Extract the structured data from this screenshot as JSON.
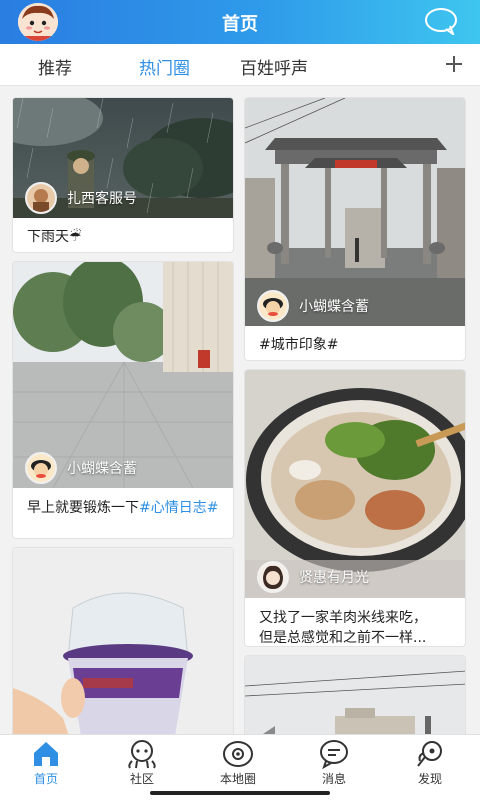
{
  "header": {
    "title": "首页"
  },
  "tabs": [
    {
      "label": "推荐"
    },
    {
      "label": "热门圈"
    },
    {
      "label": "百姓呼声"
    }
  ],
  "cards": [
    {
      "user": "扎西客服号",
      "caption": "下雨天☔"
    },
    {
      "user": "小蝴蝶含蓄",
      "caption": "#城市印象#"
    },
    {
      "user": "小蝴蝶含蓄",
      "caption_text": "早上就要锻炼一下",
      "caption_tag": "#心情日志#"
    },
    {
      "user": "贤惠有月光",
      "caption_line1": "又找了一家羊肉米线来吃，",
      "caption_line2": "但是总感觉和之前不一样..."
    }
  ],
  "bottom_nav": [
    {
      "label": "首页",
      "icon": "home-icon"
    },
    {
      "label": "社区",
      "icon": "community-icon"
    },
    {
      "label": "本地圈",
      "icon": "local-circle-icon"
    },
    {
      "label": "消息",
      "icon": "message-icon"
    },
    {
      "label": "发现",
      "icon": "discover-icon"
    }
  ],
  "colors": {
    "accent": "#2f8fe4",
    "header_start": "#2a7de1",
    "header_end": "#3ec6ef"
  }
}
